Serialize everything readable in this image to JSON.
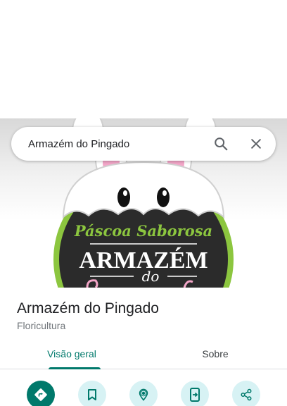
{
  "search": {
    "query": "Armazém do Pingado",
    "search_icon": "search-icon",
    "close_icon": "close-icon"
  },
  "hero_image": {
    "sign_line1": "Páscoa Saborosa",
    "sign_line2": "ARMAZÉM",
    "sign_line3": "do",
    "colors": {
      "green": "#8cc63f",
      "dark": "#2b2b2b",
      "pink": "#f3a6c8",
      "white": "#ffffff"
    }
  },
  "place": {
    "title": "Armazém do Pingado",
    "category": "Floricultura"
  },
  "tabs": [
    {
      "label": "Visão geral",
      "active": true
    },
    {
      "label": "Sobre",
      "active": false
    }
  ],
  "actions": [
    {
      "icon": "directions-icon",
      "primary": true
    },
    {
      "icon": "bookmark-icon",
      "primary": false
    },
    {
      "icon": "nearby-icon",
      "primary": false
    },
    {
      "icon": "send-to-phone-icon",
      "primary": false
    },
    {
      "icon": "share-icon",
      "primary": false
    }
  ],
  "theme": {
    "accent": "#00796b",
    "action_bg": "#d7f2f4",
    "text": "#202124",
    "subtext": "#70757a"
  }
}
